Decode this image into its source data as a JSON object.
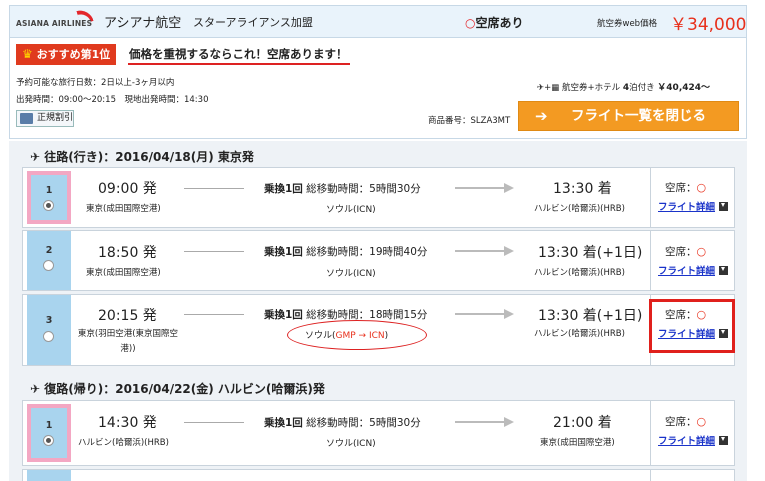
{
  "header": {
    "airline_logo_text": "ASIANA AIRLINES",
    "airline_name": "アシアナ航空",
    "alliance": "スターアライアンス加盟",
    "seat_status_mark": "○",
    "seat_status_text": "空席あり",
    "price_label": "航空券web価格",
    "price": "￥34,000",
    "badge_label": "おすすめ第1位",
    "badge_icon": "crown-icon",
    "catchphrase": "価格を重視するならこれ！空席あります！",
    "travel_days": "予約可能な旅行日数：2日以上-3ヶ月以内",
    "departure_times": "出発時間：09:00～20:15　現地出発時間：14:30",
    "tag_label": "正規割引",
    "hotel_plan": "航空券+ホテル",
    "hotel_nights_num": "4",
    "hotel_nights_unit": "泊付き",
    "hotel_price": "￥40,424～",
    "product_no": "商品番号：SLZA3MT",
    "close_button_label": "フライト一覧を閉じる",
    "close_button_icon": "arrow-right-icon"
  },
  "outbound": {
    "title": "往路(行き)：2016/04/18(月) 東京発",
    "icon": "plane-takeoff-icon",
    "flights": [
      {
        "index": "1",
        "selected": true,
        "dep": "09:00 発",
        "dep_ap": "東京(成田国際空港)",
        "xfer": "乗換1回",
        "duration": "総移動時間：5時間30分",
        "via": "ソウル(ICN)",
        "arr": "13:30 着",
        "arr_ap": "ハルビン(哈爾浜)(HRB)",
        "seat_label": "空席：",
        "seat_mark": "○",
        "detail": "フライト詳細"
      },
      {
        "index": "2",
        "selected": false,
        "dep": "18:50 発",
        "dep_ap": "東京(成田国際空港)",
        "xfer": "乗換1回",
        "duration": "総移動時間：19時間40分",
        "via": "ソウル(ICN)",
        "arr": "13:30 着(+1日)",
        "arr_ap": "ハルビン(哈爾浜)(HRB)",
        "seat_label": "空席：",
        "seat_mark": "○",
        "detail": "フライト詳細"
      },
      {
        "index": "3",
        "selected": false,
        "dep": "20:15 発",
        "dep_ap": "東京(羽田空港(東京国際空港))",
        "xfer": "乗換1回",
        "duration": "総移動時間：18時間15分",
        "via": "ソウル(",
        "via_red": "GMP → ICN",
        "via_end": ")",
        "arr": "13:30 着(+1日)",
        "arr_ap": "ハルビン(哈爾浜)(HRB)",
        "seat_label": "空席：",
        "seat_mark": "○",
        "detail": "フライト詳細"
      }
    ]
  },
  "return": {
    "title": "復路(帰り)：2016/04/22(金) ハルビン(哈爾浜)発",
    "icon": "plane-landing-icon",
    "flights": [
      {
        "index": "1",
        "selected": true,
        "dep": "14:30 発",
        "dep_ap": "ハルビン(哈爾浜)(HRB)",
        "xfer": "乗換1回",
        "duration": "総移動時間：5時間30分",
        "via": "ソウル(ICN)",
        "arr": "21:00 着",
        "arr_ap": "東京(成田国際空港)",
        "seat_label": "空席：",
        "seat_mark": "○",
        "detail": "フライト詳細"
      }
    ]
  }
}
